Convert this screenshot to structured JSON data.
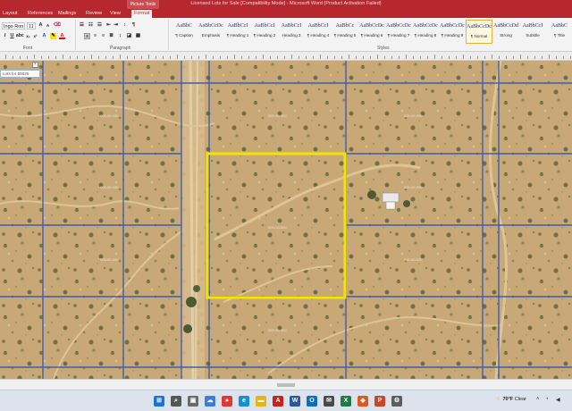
{
  "window": {
    "title": "Licensed Lots for Sale [Compatibility Mode] - Microsoft Word (Product Activation Failed)",
    "context_tab_group": "Picture Tools"
  },
  "tabs": [
    {
      "label": "Layout"
    },
    {
      "label": "References"
    },
    {
      "label": "Mailings"
    },
    {
      "label": "Review"
    },
    {
      "label": "View"
    },
    {
      "label": "Format"
    }
  ],
  "ribbon": {
    "font_name": "Ingo Ron",
    "font_size": "11",
    "groups": {
      "font": "Font",
      "paragraph": "Paragraph",
      "styles": "Styles"
    },
    "styles": [
      {
        "preview": "AaBbC",
        "name": "¶ Caption"
      },
      {
        "preview": "AaBbCcDc",
        "name": "Emphasis"
      },
      {
        "preview": "AaBbCcI",
        "name": "¶ Heading 1"
      },
      {
        "preview": "AaBbCcI",
        "name": "¶ Heading 2"
      },
      {
        "preview": "AaBbCcI",
        "name": "Heading 3"
      },
      {
        "preview": "AaBbCcI",
        "name": "¶ Heading 4"
      },
      {
        "preview": "AaBbCc",
        "name": "¶ Heading 5"
      },
      {
        "preview": "AaBbCcDc",
        "name": "¶ Heading 6"
      },
      {
        "preview": "AaBbCcDc",
        "name": "¶ Heading 7"
      },
      {
        "preview": "AaBbCcDc",
        "name": "¶ Heading 8"
      },
      {
        "preview": "AaBbCcDc",
        "name": "¶ Heading 9"
      },
      {
        "preview": "AaBbCcDc",
        "name": "¶ Normal",
        "selected": true
      },
      {
        "preview": "AaBbCcDd",
        "name": "Strong"
      },
      {
        "preview": "AaBbCcI",
        "name": "Subtitle"
      },
      {
        "preview": "AaBbC",
        "name": "¶ Title"
      }
    ]
  },
  "map": {
    "search_text": "Lots for 50025",
    "highlight_color": "#f2e600",
    "parcel_line_color": "#2f55b8",
    "parcel_labels": [
      "000-00-000",
      "000-00-000",
      "000-00-000",
      "000-00-000",
      "000-00-000",
      "000-00-000",
      "000-00-000",
      "000-00-000",
      "000-00-000"
    ]
  },
  "taskbar": {
    "apps": [
      {
        "icon": "windows-start-icon",
        "color": "#1e73d2",
        "glyph": "⊞"
      },
      {
        "icon": "search-icon",
        "color": "#555555",
        "glyph": "⌕"
      },
      {
        "icon": "task-view-icon",
        "color": "#6a6a6a",
        "glyph": "▣"
      },
      {
        "icon": "widgets-icon",
        "color": "#3b7dd8",
        "glyph": "☁"
      },
      {
        "icon": "chrome-icon",
        "color": "#de3b2f",
        "glyph": "●"
      },
      {
        "icon": "edge-icon",
        "color": "#1a8fcf",
        "glyph": "e"
      },
      {
        "icon": "file-explorer-icon",
        "color": "#e7b416",
        "glyph": "▬"
      },
      {
        "icon": "acrobat-icon",
        "color": "#c4231f",
        "glyph": "A"
      },
      {
        "icon": "word-icon",
        "color": "#2b579a",
        "glyph": "W"
      },
      {
        "icon": "outlook-icon",
        "color": "#0f6cbd",
        "glyph": "O"
      },
      {
        "icon": "mail-icon",
        "color": "#4a4a4a",
        "glyph": "✉"
      },
      {
        "icon": "excel-icon",
        "color": "#1f7a45",
        "glyph": "X"
      },
      {
        "icon": "brave-icon",
        "color": "#e2571e",
        "glyph": "◆"
      },
      {
        "icon": "powerpoint-icon",
        "color": "#c8462b",
        "glyph": "P"
      },
      {
        "icon": "settings-icon",
        "color": "#5d5d5d",
        "glyph": "⚙"
      }
    ],
    "weather_temp": "70°F",
    "weather_desc": "Clear"
  }
}
